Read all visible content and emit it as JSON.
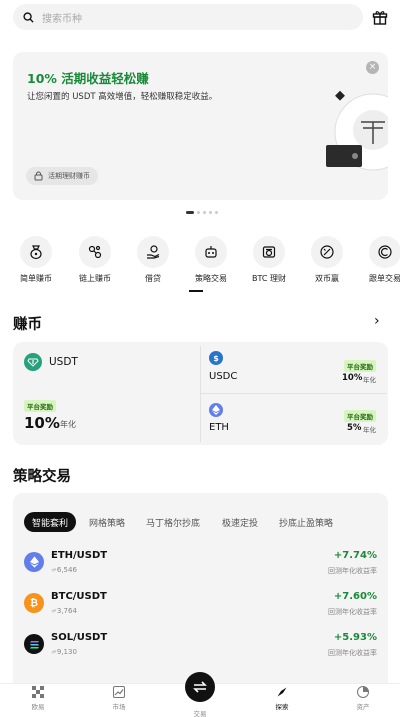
{
  "search": {
    "placeholder": "搜索币种"
  },
  "banner": {
    "title": "10% 活期收益轻松赚",
    "subtitle": "让您闲置的 USDT 高效增值，轻松赚取稳定收益。",
    "chip": "活期理财赚币",
    "dots_total": 5,
    "dots_active": 0
  },
  "quick_menu": [
    {
      "label": "简单赚币",
      "icon": "moneybag-icon"
    },
    {
      "label": "链上赚币",
      "icon": "chain-icon"
    },
    {
      "label": "借贷",
      "icon": "loan-icon"
    },
    {
      "label": "策略交易",
      "icon": "robot-icon"
    },
    {
      "label": "BTC 理财",
      "icon": "btc-wallet-icon"
    },
    {
      "label": "双币赢",
      "icon": "dual-coin-icon"
    },
    {
      "label": "跟单交易",
      "icon": "copy-trade-icon"
    }
  ],
  "earn": {
    "title": "赚币",
    "usdt": {
      "name": "USDT",
      "tag": "平台奖励",
      "rate": "10%",
      "rate_label": "年化"
    },
    "usdc": {
      "name": "USDC",
      "tag": "平台奖励",
      "rate": "10%",
      "rate_label": "年化"
    },
    "eth": {
      "name": "ETH",
      "tag": "平台奖励",
      "rate": "5%",
      "rate_label": "年化"
    }
  },
  "strategy": {
    "title": "策略交易",
    "tabs": [
      "智能套利",
      "网格策略",
      "马丁格尔抄底",
      "极速定投",
      "抄底止盈策略"
    ],
    "rows": [
      {
        "pair": "ETH/USDT",
        "users": "6,546",
        "rate": "+7.74%",
        "rate_label": "回测年化收益率"
      },
      {
        "pair": "BTC/USDT",
        "users": "3,764",
        "rate": "+7.60%",
        "rate_label": "回测年化收益率"
      },
      {
        "pair": "SOL/USDT",
        "users": "9,130",
        "rate": "+5.93%",
        "rate_label": "回测年化收益率"
      }
    ]
  },
  "bottom_nav": [
    "欧易",
    "市场",
    "交易",
    "探索",
    "资产"
  ],
  "colors": {
    "green": "#1a8a3a",
    "tag_bg": "#d6f5be",
    "usdt": "#26a17b",
    "usdc": "#2775ca",
    "eth": "#627eea",
    "btc": "#f7931a"
  }
}
